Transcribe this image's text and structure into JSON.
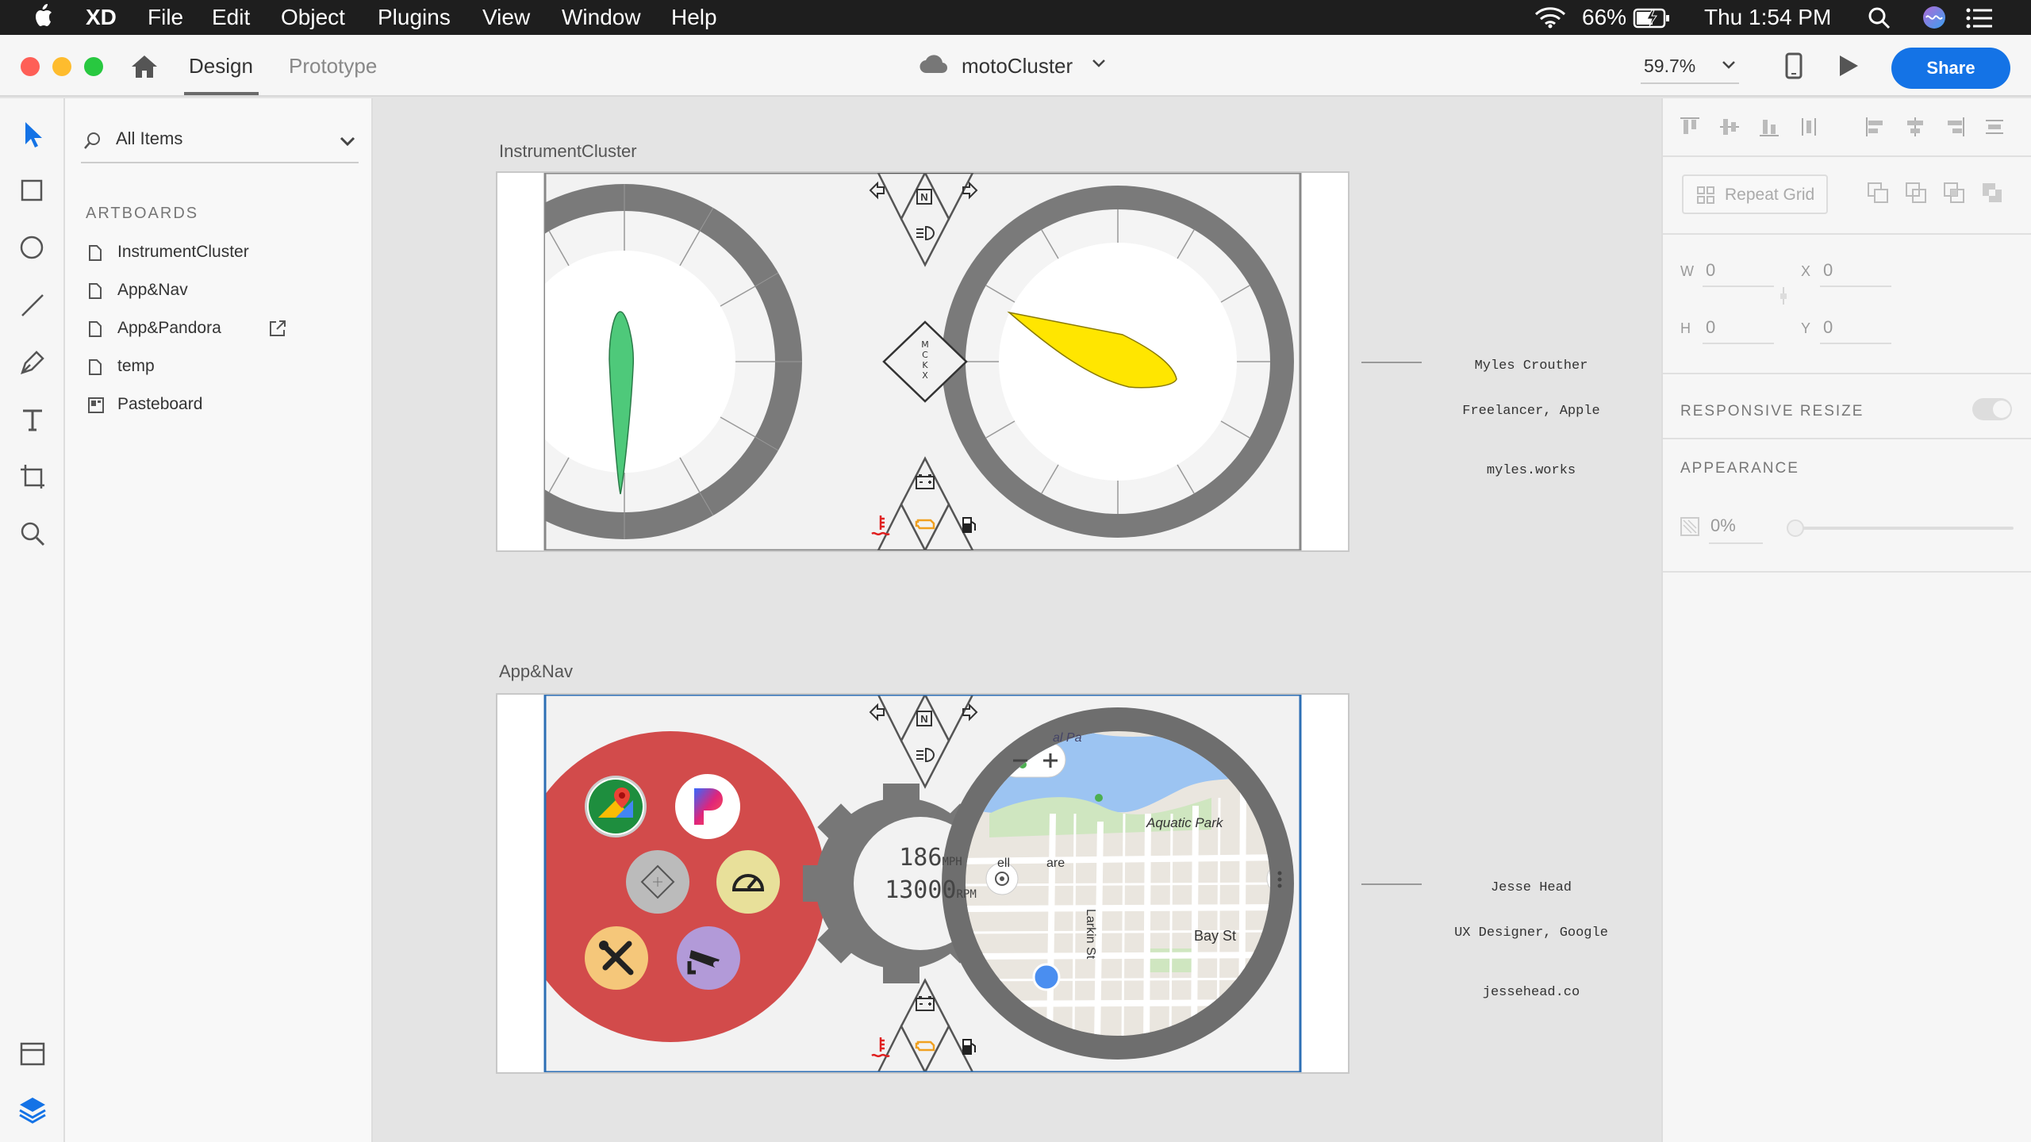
{
  "menubar": {
    "app": "XD",
    "items": [
      "File",
      "Edit",
      "Object",
      "Plugins",
      "View",
      "Window",
      "Help"
    ],
    "battery": "66%",
    "clock": "Thu 1:54 PM"
  },
  "titlebar": {
    "tabs": [
      "Design",
      "Prototype"
    ],
    "active_tab": "Design",
    "document": "motoCluster",
    "zoom": "59.7%",
    "share": "Share"
  },
  "layers": {
    "filter": "All Items",
    "section": "ARTBOARDS",
    "items": [
      {
        "label": "InstrumentCluster",
        "icon": "artboard-icon"
      },
      {
        "label": "App&Nav",
        "icon": "artboard-icon"
      },
      {
        "label": "App&Pandora",
        "icon": "artboard-icon",
        "badge": "external-link-icon"
      },
      {
        "label": "temp",
        "icon": "artboard-icon"
      },
      {
        "label": "Pasteboard",
        "icon": "pasteboard-icon"
      }
    ]
  },
  "canvas": {
    "artboard1": {
      "title": "InstrumentCluster",
      "credit": {
        "name": "Myles Crouther",
        "role": "Freelancer, Apple",
        "site": "myles.works"
      },
      "center_logo": [
        "M",
        "C",
        "K",
        "X"
      ]
    },
    "artboard2": {
      "title": "App&Nav",
      "credit": {
        "name": "Jesse Head",
        "role": "UX Designer, Google",
        "site": "jessehead.co"
      },
      "speed": "186",
      "speed_unit": "MPH",
      "rpm": "13000",
      "rpm_unit": "RPM",
      "map_labels": [
        "Aquatic Park",
        "Larkin St",
        "Bay St",
        "ell",
        "are",
        "al Pa"
      ]
    },
    "indicators": {
      "gear": "N"
    }
  },
  "inspector": {
    "repeat_grid": "Repeat Grid",
    "w_label": "W",
    "w": "0",
    "x_label": "X",
    "x": "0",
    "h_label": "H",
    "h": "0",
    "y_label": "Y",
    "y": "0",
    "responsive": "RESPONSIVE RESIZE",
    "appearance": "APPEARANCE",
    "opacity": "0%"
  },
  "colors": {
    "share": "#1473e6",
    "tach_needle": "#4ec97a",
    "speed_needle": "#ffe600",
    "app_circle": "#d24b4b",
    "selection": "#2d6fb5"
  }
}
